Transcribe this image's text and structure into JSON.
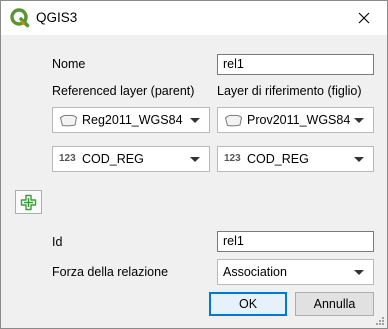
{
  "window": {
    "title": "QGIS3",
    "icon": "qgis-logo-icon",
    "close_icon": "close-icon"
  },
  "form": {
    "nome_label": "Nome",
    "nome_value": "rel1",
    "parent_header": "Referenced layer (parent)",
    "child_header": "Layer di riferimento (figlio)",
    "parent_layer": "Reg2011_WGS84",
    "child_layer": "Prov2011_WGS84",
    "field_type_glyph": "123",
    "parent_field": "COD_REG",
    "child_field": "COD_REG",
    "id_label": "Id",
    "id_value": "rel1",
    "strength_label": "Forza della relazione",
    "strength_value": "Association"
  },
  "buttons": {
    "ok": "OK",
    "cancel": "Annulla"
  },
  "colors": {
    "accent": "#0078d7",
    "add_icon": "#3c9b3c",
    "qgis_green": "#589632",
    "qgis_yellow": "#ee7913"
  }
}
